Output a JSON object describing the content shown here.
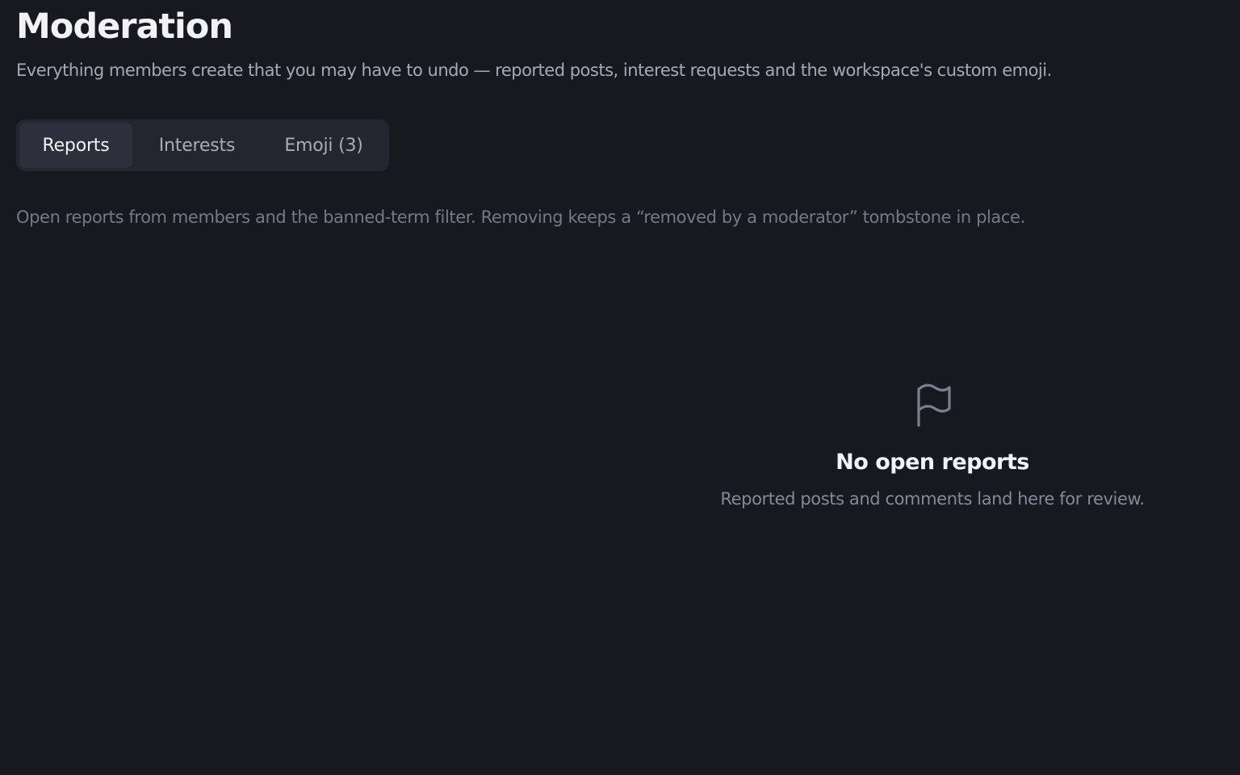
{
  "header": {
    "title": "Moderation",
    "subtitle": "Everything members create that you may have to undo — reported posts, interest requests and the workspace's custom emoji."
  },
  "tabs": [
    {
      "label": "Reports",
      "active": true
    },
    {
      "label": "Interests",
      "active": false
    },
    {
      "label": "Emoji (3)",
      "active": false
    }
  ],
  "reports": {
    "description": "Open reports from members and the banned-term filter. Removing keeps a “removed by a moderator” tombstone in place.",
    "empty_state": {
      "icon": "flag-icon",
      "title": "No open reports",
      "text": "Reported posts and comments land here for review."
    }
  },
  "colors": {
    "background": "#181821",
    "tab_bar": "#232530",
    "tab_active": "#2d303c",
    "text_primary": "#f2f2f5",
    "text_secondary": "#a7a8b6",
    "text_muted": "#767888",
    "icon": "#7c7f8e"
  }
}
